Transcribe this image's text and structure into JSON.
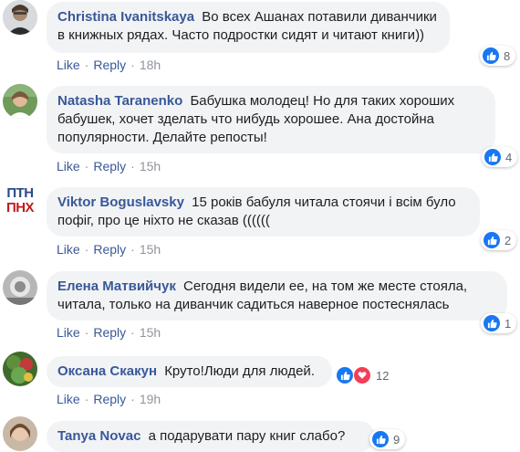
{
  "actions": {
    "like": "Like",
    "reply": "Reply",
    "separator": "·"
  },
  "colors": {
    "name": "#385898",
    "bubble": "#f2f3f5",
    "like": "#1877f2",
    "love": "#f33e58",
    "meta": "#90949c"
  },
  "comments": [
    {
      "name": "Christina Ivanitskaya",
      "text": "Во всех Ашанах потавили диванчики в книжных рядах. Часто подростки сидят и читают книги))",
      "time": "18h",
      "reactions": "8",
      "reaction_icons": [
        "like-icon"
      ]
    },
    {
      "name": "Natasha Taranenko",
      "text": "Бабушка молодец! Но для таких хороших бабушек, хочет зделать что нибудь хорошее. Ана достойна популярности. Делайте репосты!",
      "time": "15h",
      "reactions": "4",
      "reaction_icons": [
        "like-icon"
      ]
    },
    {
      "name": "Viktor Boguslavsky",
      "text": "15 років бабуля читала стоячи і всім було пофіг, про це ніхто не сказав ((((((",
      "time": "15h",
      "reactions": "2",
      "reaction_icons": [
        "like-icon"
      ],
      "avatar_text_top": "ПТН",
      "avatar_text_bottom": "ПНХ"
    },
    {
      "name": "Елена Матвийчук",
      "text": "Сегодня видели ее, на том же месте стояла, читала, только на диванчик садиться наверное постеснялась",
      "time": "15h",
      "reactions": "1",
      "reaction_icons": [
        "like-icon"
      ]
    },
    {
      "name": "Оксана Скакун",
      "text": "Круто!Люди для людей.",
      "time": "19h",
      "reactions": "12",
      "reaction_icons": [
        "like-icon",
        "love-icon"
      ]
    },
    {
      "name": "Tanya Novac",
      "text": "а подарувати пару книг слабо?",
      "time": "",
      "reactions": "9",
      "reaction_icons": [
        "like-icon"
      ]
    }
  ]
}
